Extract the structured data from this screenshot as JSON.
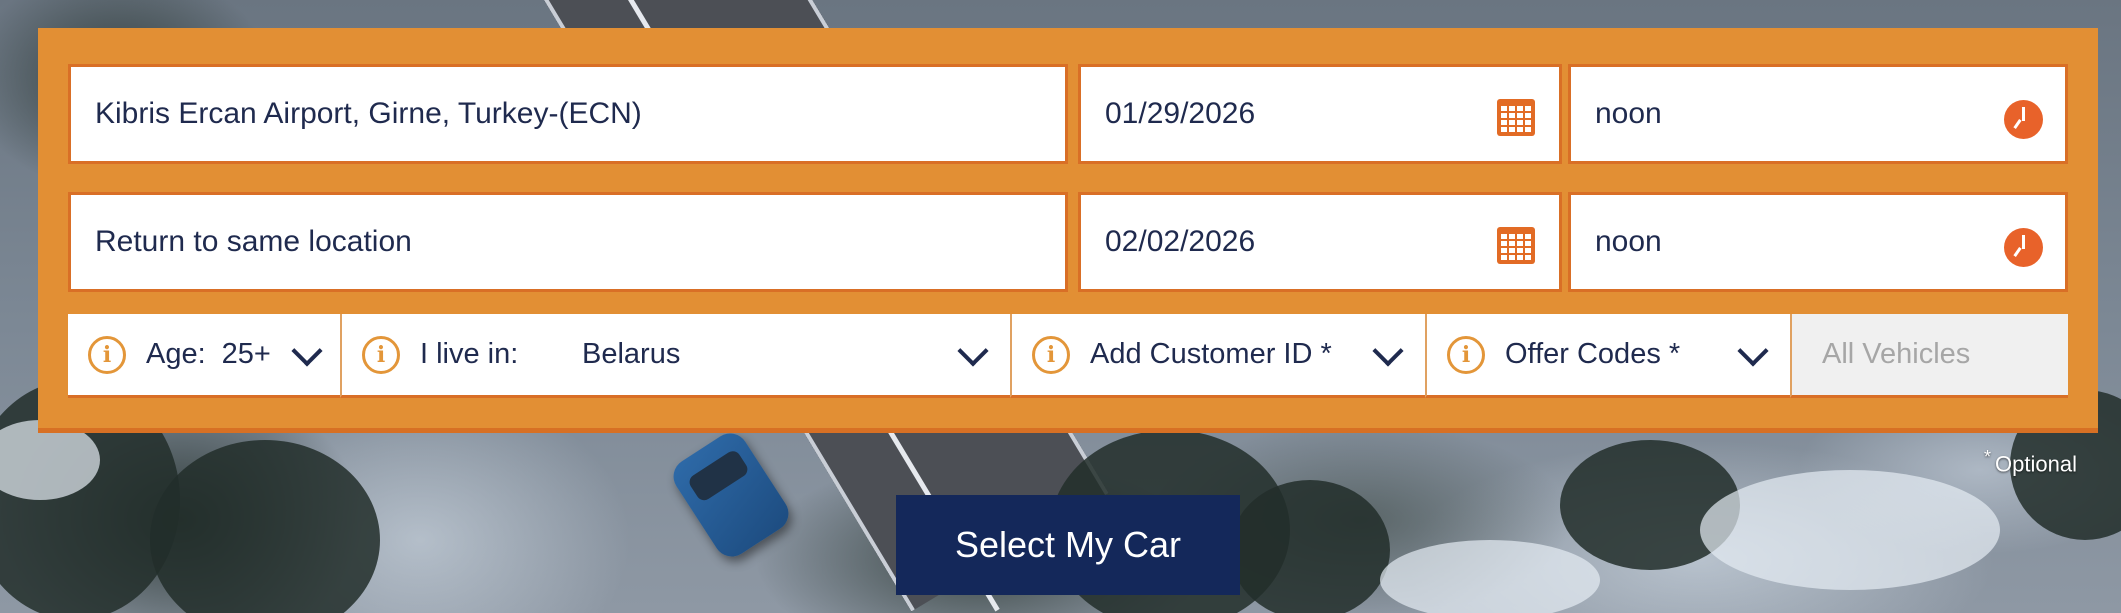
{
  "search": {
    "pickup_location": "Kibris Ercan Airport, Girne, Turkey-(ECN)",
    "pickup_date": "01/29/2026",
    "pickup_time": "noon",
    "return_location": "Return to same location",
    "return_date": "02/02/2026",
    "return_time": "noon"
  },
  "options": {
    "age_label": "Age:",
    "age_value": "25+",
    "live_label": "I live in:",
    "live_value": "Belarus",
    "customer_id": "Add Customer ID *",
    "offer_codes": "Offer Codes *",
    "vehicles": "All Vehicles"
  },
  "footnote": {
    "marker": "*",
    "text": "Optional"
  },
  "cta": {
    "label": "Select My Car"
  },
  "icons": {
    "info": "info-icon",
    "calendar": "calendar-icon",
    "clock": "clock-icon",
    "dropdown": "chevron-down-icon"
  },
  "colors": {
    "panel": "#e28f34",
    "accent": "#e26b25",
    "text": "#1f2a4e",
    "button": "#14285a"
  }
}
